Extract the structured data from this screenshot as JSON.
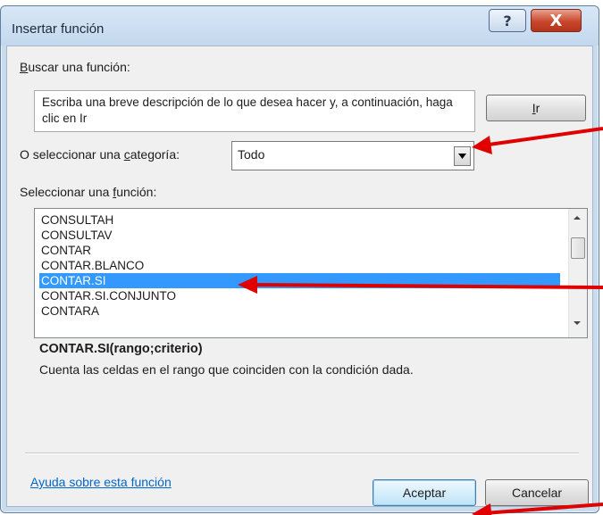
{
  "dialog": {
    "title": "Insertar función",
    "help_glyph": "?",
    "close_glyph": "X"
  },
  "search": {
    "label_accel": "B",
    "label_rest": "uscar una función:",
    "description": "Escriba una breve descripción de lo que desea hacer y, a continuación, haga clic en Ir",
    "go_button_accel": "I",
    "go_button_rest": "r"
  },
  "category": {
    "label_pre": "O seleccionar una ",
    "label_accel": "c",
    "label_post": "ategoría:",
    "selected": "Todo"
  },
  "function_list": {
    "label_pre": "Seleccionar una ",
    "label_accel": "f",
    "label_post": "unción:",
    "items": [
      "CONSULTAH",
      "CONSULTAV",
      "CONTAR",
      "CONTAR.BLANCO",
      "CONTAR.SI",
      "CONTAR.SI.CONJUNTO",
      "CONTARA"
    ],
    "selected_index": 4
  },
  "function_info": {
    "signature": "CONTAR.SI(rango;criterio)",
    "description": "Cuenta las celdas en el rango que coinciden con la condición dada."
  },
  "footer": {
    "help_link": "Ayuda sobre esta función",
    "ok_label": "Aceptar",
    "cancel_label": "Cancelar"
  },
  "colors": {
    "selection": "#3399ff",
    "annotation_arrow": "#e00000",
    "link": "#0066cc"
  }
}
